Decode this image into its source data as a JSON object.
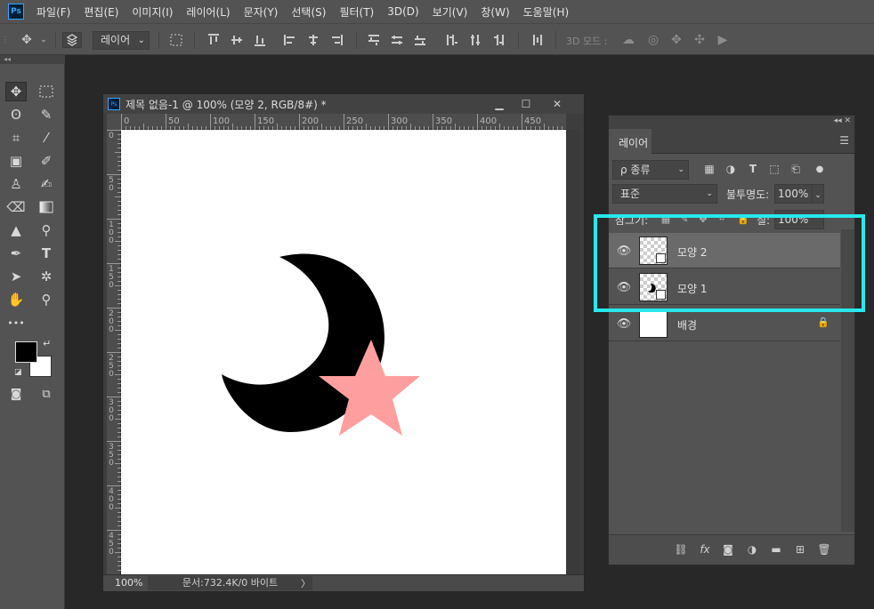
{
  "app": {
    "logo": "Ps",
    "accent": "#31a8ff"
  },
  "menu": [
    "파일(F)",
    "편집(E)",
    "이미지(I)",
    "레이어(L)",
    "문자(Y)",
    "선택(S)",
    "필터(T)",
    "3D(D)",
    "보기(V)",
    "창(W)",
    "도움말(H)"
  ],
  "options": {
    "mode": "레이어",
    "mode3d": "3D 모드 :"
  },
  "tools": {
    "grip": "◂◂",
    "more": "•••"
  },
  "document": {
    "title": "제목 없음-1 @ 100% (모양 2, RGB/8#) *",
    "zoom": "100%",
    "info": "문서:732.4K/0 바이트",
    "info_arrow": "〉",
    "ruler_top": [
      "0",
      "50",
      "100",
      "150",
      "200",
      "250",
      "300",
      "350",
      "400",
      "450"
    ],
    "ruler_left": [
      "0",
      "5\n0",
      "1\n0\n0",
      "1\n5\n0",
      "2\n0\n0",
      "2\n5\n0",
      "3\n0\n0",
      "3\n5\n0",
      "4\n0\n0",
      "4\n5\n0"
    ]
  },
  "shapes": {
    "moon_color": "#000000",
    "star_color": "#ff9e9e"
  },
  "layers_panel": {
    "grip": "◂◂ ✕",
    "tab": "레이어",
    "filter": "ρ 종류",
    "blend": "표준",
    "opacity_label": "불투명도:",
    "opacity_value": "100%",
    "lock_label": "잠그기:",
    "fill_label": "칠:",
    "fill_value": "100%",
    "layers": [
      {
        "name": "모양 2",
        "selected": true
      },
      {
        "name": "모양 1",
        "selected": false
      },
      {
        "name": "배경",
        "selected": false
      }
    ]
  },
  "highlight_color": "#27e8ed"
}
